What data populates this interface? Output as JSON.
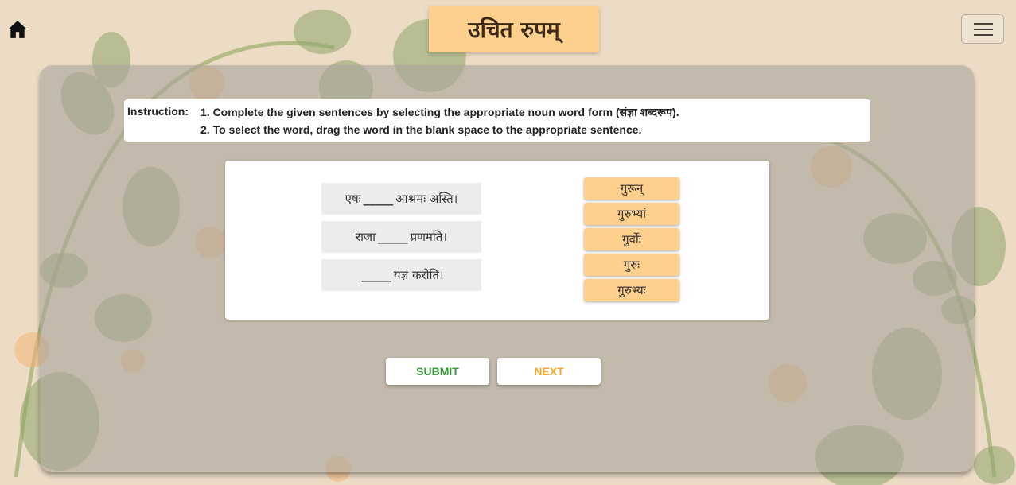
{
  "header": {
    "title": "उचित रुपम्",
    "home_icon": "home-icon",
    "menu_icon": "hamburger-menu-icon"
  },
  "instruction": {
    "label": "Instruction:",
    "line1": "1. Complete the given sentences by selecting the appropriate noun word form (संज्ञा शब्दरूप).",
    "line2": "2. To select the word, drag the word in the blank space to the appropriate sentence."
  },
  "sentences": [
    {
      "before": "एषः",
      "blank": "_____",
      "after": "आश्रमः अस्ति।"
    },
    {
      "before": "राजा",
      "blank": "_____",
      "after": "प्रणमति।"
    },
    {
      "before": "",
      "blank": "_____",
      "after": "यज्ञं करोति।"
    }
  ],
  "words": [
    "गुरून्",
    "गुरुभ्यां",
    "गुर्वोः",
    "गुरुः",
    "गुरुभ्यः"
  ],
  "buttons": {
    "submit": "SUBMIT",
    "next": "NEXT"
  },
  "colors": {
    "background": "#ecdcc6",
    "title_bg": "#fdd08e",
    "word_bg": "#fdd08e",
    "submit_text": "#3c9a3c",
    "next_text": "#f5a623"
  }
}
